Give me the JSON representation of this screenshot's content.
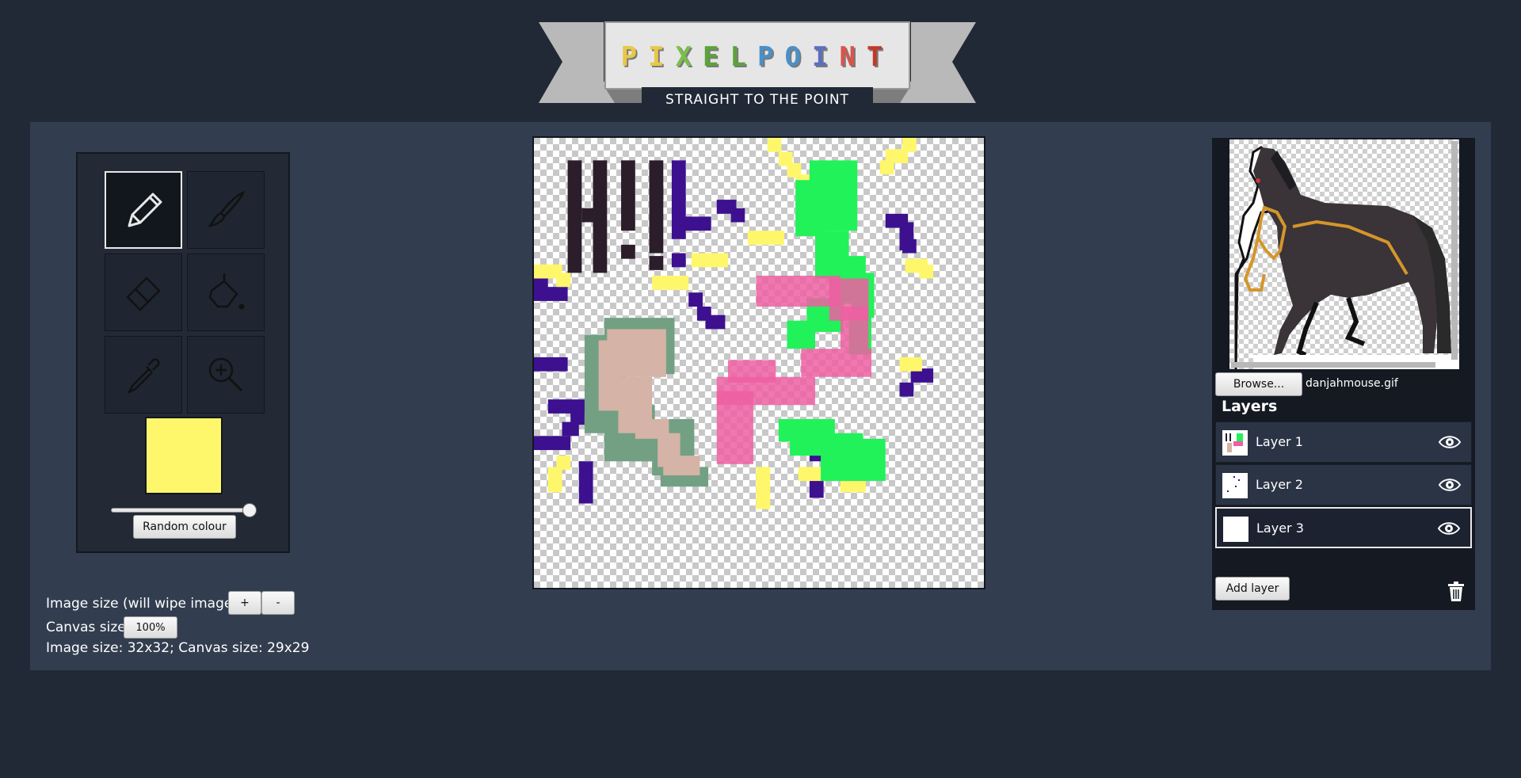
{
  "app": {
    "logo_letters": [
      {
        "ch": "P",
        "color": "#e9c846"
      },
      {
        "ch": "I",
        "color": "#e9c846"
      },
      {
        "ch": "X",
        "color": "#7bbf4b"
      },
      {
        "ch": "E",
        "color": "#5aa33a"
      },
      {
        "ch": "L",
        "color": "#5aa33a"
      },
      {
        "ch": "P",
        "color": "#4a90c7"
      },
      {
        "ch": "O",
        "color": "#4a90c7"
      },
      {
        "ch": "I",
        "color": "#5b6fbf"
      },
      {
        "ch": "N",
        "color": "#d8544a"
      },
      {
        "ch": "T",
        "color": "#c0392b"
      }
    ],
    "tagline": "STRAIGHT TO THE POINT"
  },
  "toolbox": {
    "tools": [
      {
        "id": "pencil",
        "icon": "pencil-icon",
        "selected": true
      },
      {
        "id": "brush",
        "icon": "brush-icon",
        "selected": false
      },
      {
        "id": "eraser",
        "icon": "eraser-icon",
        "selected": false
      },
      {
        "id": "fill",
        "icon": "paint-bucket-icon",
        "selected": false
      },
      {
        "id": "eyedropper",
        "icon": "eyedropper-icon",
        "selected": false
      },
      {
        "id": "zoom",
        "icon": "zoom-in-icon",
        "selected": false
      }
    ],
    "current_colour": "#fff76b",
    "size_slider_fraction": 1.0,
    "random_colour_label": "Random colour"
  },
  "image_controls": {
    "image_size_label": "Image size (will wipe image)",
    "plus_label": "+",
    "minus_label": "-",
    "canvas_size_label": "Canvas size",
    "canvas_size_value": "100%",
    "status": "Image size: 32x32; Canvas size: 29x29"
  },
  "colors": {
    "dark": "#2b1d2a",
    "purple": "#3d1090",
    "yellow": "#fff76b",
    "green": "#21f25a",
    "pink": "#ef5fa2",
    "sage": "#73a083",
    "skin": "#d5b3a6"
  },
  "reference": {
    "browse_label": "Browse...",
    "file_name": "danjahmouse.gif"
  },
  "layers": {
    "heading": "Layers",
    "items": [
      {
        "label": "Layer 1",
        "visible": true,
        "selected": false
      },
      {
        "label": "Layer 2",
        "visible": true,
        "selected": false
      },
      {
        "label": "Layer 3",
        "visible": true,
        "selected": true
      }
    ],
    "add_layer_label": "Add layer"
  }
}
